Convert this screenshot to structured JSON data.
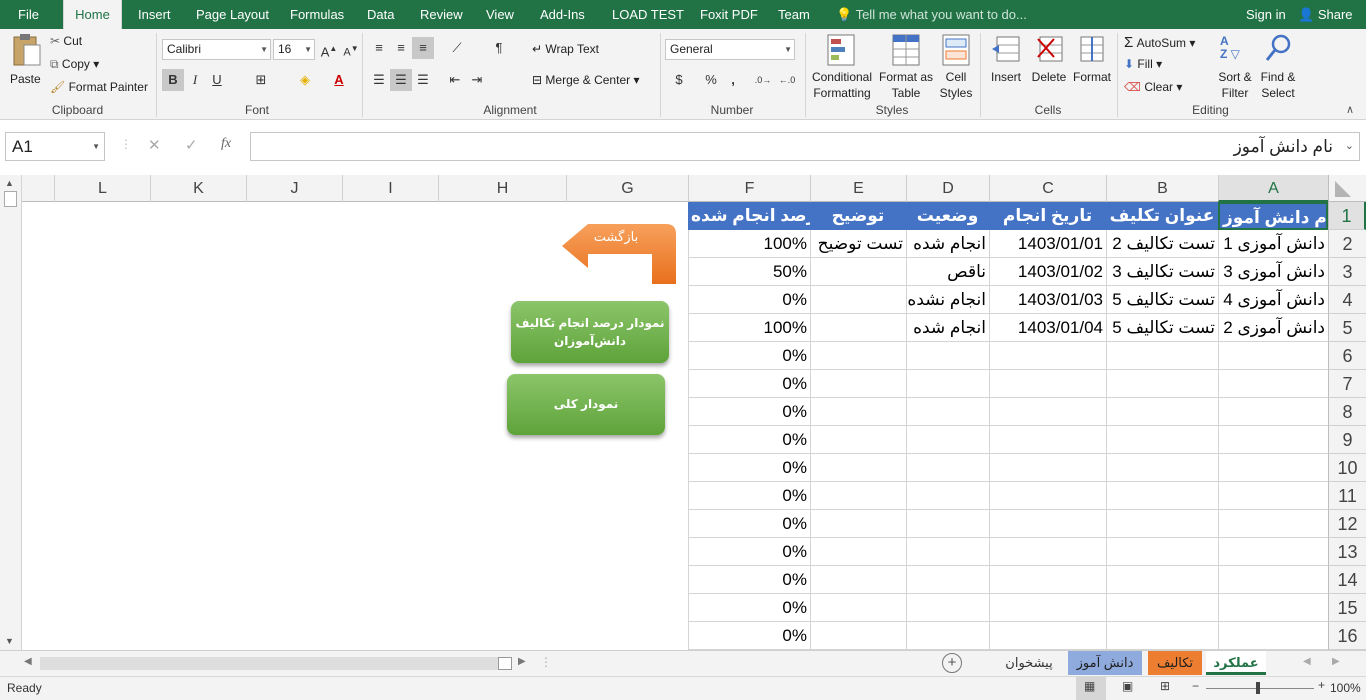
{
  "tabs": {
    "file": "File",
    "home": "Home",
    "insert": "Insert",
    "page_layout": "Page Layout",
    "formulas": "Formulas",
    "data": "Data",
    "review": "Review",
    "view": "View",
    "addins": "Add-Ins",
    "load_test": "LOAD TEST",
    "foxit": "Foxit PDF",
    "team": "Team",
    "tell_me": "Tell me what you want to do...",
    "sign_in": "Sign in",
    "share": "Share"
  },
  "ribbon": {
    "clipboard": {
      "paste": "Paste",
      "cut": "Cut",
      "copy": "Copy",
      "format_painter": "Format Painter",
      "label": "Clipboard"
    },
    "font": {
      "name": "Calibri",
      "size": "16",
      "bold": "B",
      "italic": "I",
      "underline": "U",
      "label": "Font"
    },
    "alignment": {
      "wrap_text": "Wrap Text",
      "merge_center": "Merge & Center",
      "label": "Alignment"
    },
    "number": {
      "format": "General",
      "currency": "$",
      "percent": "%",
      "comma": ",",
      "label": "Number"
    },
    "styles": {
      "conditional": "Conditional",
      "formatting": "Formatting",
      "format_as": "Format as",
      "table": "Table",
      "cell": "Cell",
      "cell_styles": "Styles",
      "label": "Styles"
    },
    "cells": {
      "insert": "Insert",
      "delete": "Delete",
      "format": "Format",
      "label": "Cells"
    },
    "editing": {
      "autosum": "AutoSum",
      "fill": "Fill",
      "clear": "Clear",
      "sort": "Sort &",
      "filter": "Filter",
      "find": "Find &",
      "select": "Select",
      "label": "Editing"
    }
  },
  "formula_bar": {
    "name_box": "A1",
    "cancel": "✕",
    "enter": "✓",
    "fx": "fx",
    "content": "نام دانش آموز"
  },
  "columns": [
    "A",
    "B",
    "C",
    "D",
    "E",
    "F",
    "G",
    "H",
    "I",
    "J",
    "K",
    "L"
  ],
  "rows": [
    "1",
    "2",
    "3",
    "4",
    "5",
    "6",
    "7",
    "8",
    "9",
    "10",
    "11",
    "12",
    "13",
    "14",
    "15",
    "16"
  ],
  "headers": {
    "a": "نام دانش آموز",
    "b": "عنوان تکلیف",
    "c": "تاریخ انجام",
    "d": "وضعیت",
    "e": "توضیح",
    "f": "درصد انجام شده"
  },
  "data_rows": [
    {
      "a": "دانش آموزی 1",
      "b": "تست تکالیف 2",
      "c": "1403/01/01",
      "d": "انجام شده",
      "e": "تست توضیح",
      "f": "100%"
    },
    {
      "a": "دانش آموزی 3",
      "b": "تست تکالیف 3",
      "c": "1403/01/02",
      "d": "ناقص",
      "e": "",
      "f": "50%"
    },
    {
      "a": "دانش آموزی 4",
      "b": "تست تکالیف 5",
      "c": "1403/01/03",
      "d": "انجام نشده",
      "e": "",
      "f": "0%"
    },
    {
      "a": "دانش آموزی 2",
      "b": "تست تکالیف 5",
      "c": "1403/01/04",
      "d": "انجام شده",
      "e": "",
      "f": "100%"
    },
    {
      "f": "0%"
    },
    {
      "f": "0%"
    },
    {
      "f": "0%"
    },
    {
      "f": "0%"
    },
    {
      "f": "0%"
    },
    {
      "f": "0%"
    },
    {
      "f": "0%"
    },
    {
      "f": "0%"
    },
    {
      "f": "0%"
    },
    {
      "f": "0%"
    },
    {
      "f": "0%"
    }
  ],
  "shapes": {
    "back": "بازگشت",
    "chart_percent": "نمودار درصد انجام تکالیف دانش‌آموزان",
    "chart_total": "نمودار کلی"
  },
  "sheets": [
    "عملکرد",
    "تکالیف",
    "دانش آموز",
    "پیشخوان"
  ],
  "status": {
    "ready": "Ready",
    "zoom": "100%"
  },
  "colors": {
    "excel_green": "#217346",
    "header_blue": "#4472c4",
    "tab_orange": "#ed7d31",
    "tab_blue": "#8faadc"
  }
}
